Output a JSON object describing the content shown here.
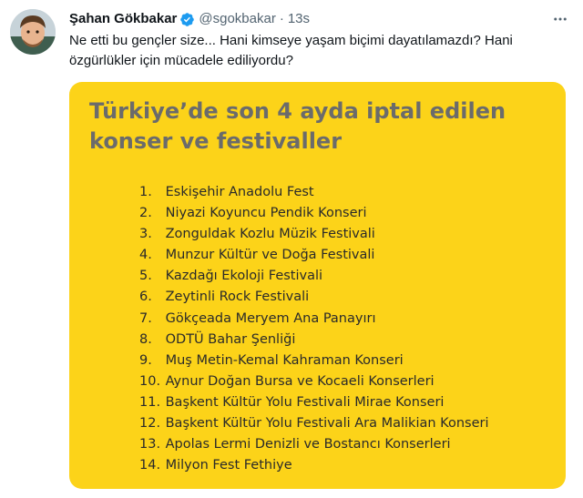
{
  "tweet": {
    "author_name": "Şahan Gökbakar",
    "handle": "@sgokbakar",
    "separator": "·",
    "time": "13s",
    "text": "Ne etti bu gençler size... Hani kimseye yaşam biçimi dayatılamazdı? Hani özgürlükler için mücadele ediliyordu?"
  },
  "card": {
    "title": "Türkiye’de son 4 ayda iptal edilen konser ve festivaller",
    "items": [
      {
        "num": "1.",
        "label": "Eskişehir Anadolu Fest"
      },
      {
        "num": "2.",
        "label": "Niyazi Koyuncu Pendik Konseri"
      },
      {
        "num": "3.",
        "label": "Zonguldak Kozlu Müzik Festivali"
      },
      {
        "num": "4.",
        "label": "Munzur Kültür ve Doğa Festivali"
      },
      {
        "num": "5.",
        "label": "Kazdağı Ekoloji Festivali"
      },
      {
        "num": "6.",
        "label": "Zeytinli Rock Festivali"
      },
      {
        "num": "7.",
        "label": "Gökçeada Meryem Ana Panayırı"
      },
      {
        "num": "8.",
        "label": "ODTÜ Bahar Şenliği"
      },
      {
        "num": "9.",
        "label": "Muş Metin-Kemal Kahraman Konseri"
      },
      {
        "num": "10.",
        "label": "Aynur Doğan Bursa ve Kocaeli Konserleri"
      },
      {
        "num": "11.",
        "label": "Başkent Kültür Yolu Festivali Mirae Konseri"
      },
      {
        "num": "12.",
        "label": "Başkent Kültür Yolu Festivali Ara Malikian Konseri"
      },
      {
        "num": "13.",
        "label": "Apolas Lermi Denizli ve Bostancı Konserleri"
      },
      {
        "num": "14.",
        "label": "Milyon Fest Fethiye"
      }
    ]
  },
  "icons": {
    "verified": "verified-badge-icon",
    "more": "more-options-icon"
  },
  "colors": {
    "card_background": "#fcd319",
    "title": "#6b6b6b",
    "verified": "#1d9bf0",
    "muted": "#536471"
  }
}
